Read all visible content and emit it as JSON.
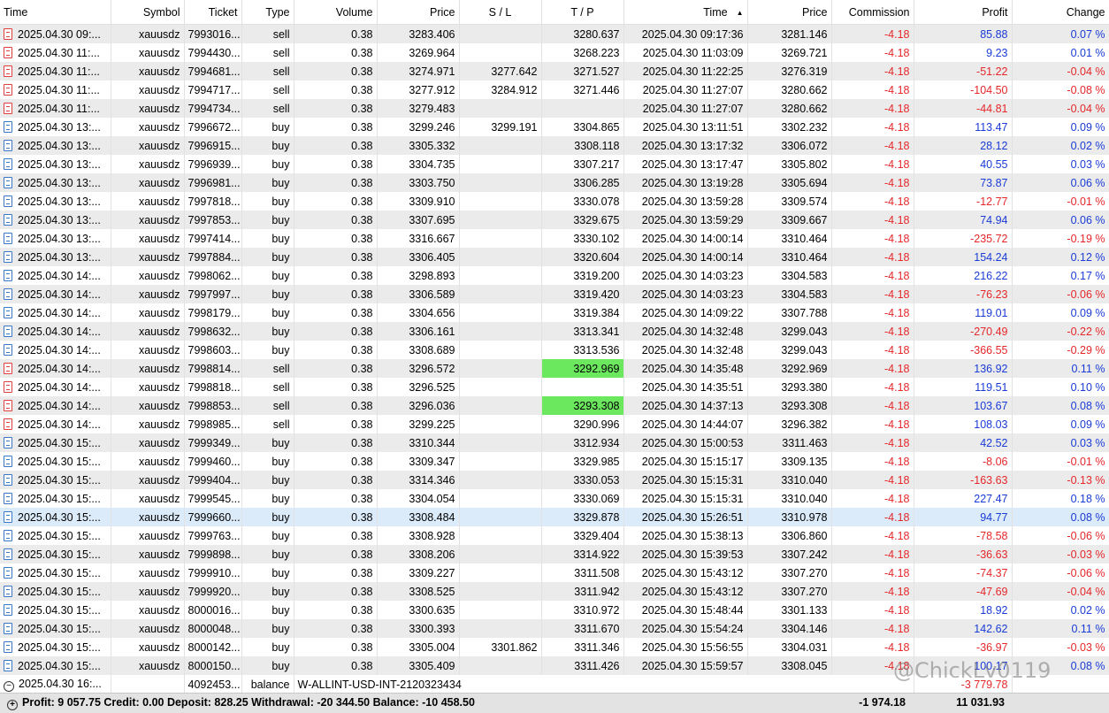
{
  "columns": [
    "Time",
    "Symbol",
    "Ticket",
    "Type",
    "Volume",
    "Price",
    "S / L",
    "T / P",
    "Time",
    "Price",
    "Commission",
    "Profit",
    "Change"
  ],
  "sorted_column_icon": "sort-ascending-icon",
  "rows": [
    {
      "type": "sell",
      "open_time": "2025.04.30 09:...",
      "symbol": "xauusdz",
      "ticket": "7993016...",
      "volume": "0.38",
      "price": "3283.406",
      "sl": "",
      "tp": "3280.637",
      "close_time": "2025.04.30 09:17:36",
      "close_price": "3281.146",
      "commission": "-4.18",
      "profit": "85.88",
      "change": "0.07 %"
    },
    {
      "type": "sell",
      "open_time": "2025.04.30 11:...",
      "symbol": "xauusdz",
      "ticket": "7994430...",
      "volume": "0.38",
      "price": "3269.964",
      "sl": "",
      "tp": "3268.223",
      "close_time": "2025.04.30 11:03:09",
      "close_price": "3269.721",
      "commission": "-4.18",
      "profit": "9.23",
      "change": "0.01 %"
    },
    {
      "type": "sell",
      "open_time": "2025.04.30 11:...",
      "symbol": "xauusdz",
      "ticket": "7994681...",
      "volume": "0.38",
      "price": "3274.971",
      "sl": "3277.642",
      "tp": "3271.527",
      "close_time": "2025.04.30 11:22:25",
      "close_price": "3276.319",
      "commission": "-4.18",
      "profit": "-51.22",
      "change": "-0.04 %"
    },
    {
      "type": "sell",
      "open_time": "2025.04.30 11:...",
      "symbol": "xauusdz",
      "ticket": "7994717...",
      "volume": "0.38",
      "price": "3277.912",
      "sl": "3284.912",
      "tp": "3271.446",
      "close_time": "2025.04.30 11:27:07",
      "close_price": "3280.662",
      "commission": "-4.18",
      "profit": "-104.50",
      "change": "-0.08 %"
    },
    {
      "type": "sell",
      "open_time": "2025.04.30 11:...",
      "symbol": "xauusdz",
      "ticket": "7994734...",
      "volume": "0.38",
      "price": "3279.483",
      "sl": "",
      "tp": "",
      "close_time": "2025.04.30 11:27:07",
      "close_price": "3280.662",
      "commission": "-4.18",
      "profit": "-44.81",
      "change": "-0.04 %"
    },
    {
      "type": "buy",
      "open_time": "2025.04.30 13:...",
      "symbol": "xauusdz",
      "ticket": "7996672...",
      "volume": "0.38",
      "price": "3299.246",
      "sl": "3299.191",
      "tp": "3304.865",
      "close_time": "2025.04.30 13:11:51",
      "close_price": "3302.232",
      "commission": "-4.18",
      "profit": "113.47",
      "change": "0.09 %"
    },
    {
      "type": "buy",
      "open_time": "2025.04.30 13:...",
      "symbol": "xauusdz",
      "ticket": "7996915...",
      "volume": "0.38",
      "price": "3305.332",
      "sl": "",
      "tp": "3308.118",
      "close_time": "2025.04.30 13:17:32",
      "close_price": "3306.072",
      "commission": "-4.18",
      "profit": "28.12",
      "change": "0.02 %"
    },
    {
      "type": "buy",
      "open_time": "2025.04.30 13:...",
      "symbol": "xauusdz",
      "ticket": "7996939...",
      "volume": "0.38",
      "price": "3304.735",
      "sl": "",
      "tp": "3307.217",
      "close_time": "2025.04.30 13:17:47",
      "close_price": "3305.802",
      "commission": "-4.18",
      "profit": "40.55",
      "change": "0.03 %"
    },
    {
      "type": "buy",
      "open_time": "2025.04.30 13:...",
      "symbol": "xauusdz",
      "ticket": "7996981...",
      "volume": "0.38",
      "price": "3303.750",
      "sl": "",
      "tp": "3306.285",
      "close_time": "2025.04.30 13:19:28",
      "close_price": "3305.694",
      "commission": "-4.18",
      "profit": "73.87",
      "change": "0.06 %"
    },
    {
      "type": "buy",
      "open_time": "2025.04.30 13:...",
      "symbol": "xauusdz",
      "ticket": "7997818...",
      "volume": "0.38",
      "price": "3309.910",
      "sl": "",
      "tp": "3330.078",
      "close_time": "2025.04.30 13:59:28",
      "close_price": "3309.574",
      "commission": "-4.18",
      "profit": "-12.77",
      "change": "-0.01 %"
    },
    {
      "type": "buy",
      "open_time": "2025.04.30 13:...",
      "symbol": "xauusdz",
      "ticket": "7997853...",
      "volume": "0.38",
      "price": "3307.695",
      "sl": "",
      "tp": "3329.675",
      "close_time": "2025.04.30 13:59:29",
      "close_price": "3309.667",
      "commission": "-4.18",
      "profit": "74.94",
      "change": "0.06 %"
    },
    {
      "type": "buy",
      "open_time": "2025.04.30 13:...",
      "symbol": "xauusdz",
      "ticket": "7997414...",
      "volume": "0.38",
      "price": "3316.667",
      "sl": "",
      "tp": "3330.102",
      "close_time": "2025.04.30 14:00:14",
      "close_price": "3310.464",
      "commission": "-4.18",
      "profit": "-235.72",
      "change": "-0.19 %"
    },
    {
      "type": "buy",
      "open_time": "2025.04.30 13:...",
      "symbol": "xauusdz",
      "ticket": "7997884...",
      "volume": "0.38",
      "price": "3306.405",
      "sl": "",
      "tp": "3320.604",
      "close_time": "2025.04.30 14:00:14",
      "close_price": "3310.464",
      "commission": "-4.18",
      "profit": "154.24",
      "change": "0.12 %"
    },
    {
      "type": "buy",
      "open_time": "2025.04.30 14:...",
      "symbol": "xauusdz",
      "ticket": "7998062...",
      "volume": "0.38",
      "price": "3298.893",
      "sl": "",
      "tp": "3319.200",
      "close_time": "2025.04.30 14:03:23",
      "close_price": "3304.583",
      "commission": "-4.18",
      "profit": "216.22",
      "change": "0.17 %"
    },
    {
      "type": "buy",
      "open_time": "2025.04.30 14:...",
      "symbol": "xauusdz",
      "ticket": "7997997...",
      "volume": "0.38",
      "price": "3306.589",
      "sl": "",
      "tp": "3319.420",
      "close_time": "2025.04.30 14:03:23",
      "close_price": "3304.583",
      "commission": "-4.18",
      "profit": "-76.23",
      "change": "-0.06 %"
    },
    {
      "type": "buy",
      "open_time": "2025.04.30 14:...",
      "symbol": "xauusdz",
      "ticket": "7998179...",
      "volume": "0.38",
      "price": "3304.656",
      "sl": "",
      "tp": "3319.384",
      "close_time": "2025.04.30 14:09:22",
      "close_price": "3307.788",
      "commission": "-4.18",
      "profit": "119.01",
      "change": "0.09 %"
    },
    {
      "type": "buy",
      "open_time": "2025.04.30 14:...",
      "symbol": "xauusdz",
      "ticket": "7998632...",
      "volume": "0.38",
      "price": "3306.161",
      "sl": "",
      "tp": "3313.341",
      "close_time": "2025.04.30 14:32:48",
      "close_price": "3299.043",
      "commission": "-4.18",
      "profit": "-270.49",
      "change": "-0.22 %"
    },
    {
      "type": "buy",
      "open_time": "2025.04.30 14:...",
      "symbol": "xauusdz",
      "ticket": "7998603...",
      "volume": "0.38",
      "price": "3308.689",
      "sl": "",
      "tp": "3313.536",
      "close_time": "2025.04.30 14:32:48",
      "close_price": "3299.043",
      "commission": "-4.18",
      "profit": "-366.55",
      "change": "-0.29 %"
    },
    {
      "type": "sell",
      "open_time": "2025.04.30 14:...",
      "symbol": "xauusdz",
      "ticket": "7998814...",
      "volume": "0.38",
      "price": "3296.572",
      "sl": "",
      "tp": "3292.969",
      "tp_hit": true,
      "close_time": "2025.04.30 14:35:48",
      "close_price": "3292.969",
      "commission": "-4.18",
      "profit": "136.92",
      "change": "0.11 %"
    },
    {
      "type": "sell",
      "open_time": "2025.04.30 14:...",
      "symbol": "xauusdz",
      "ticket": "7998818...",
      "volume": "0.38",
      "price": "3296.525",
      "sl": "",
      "tp": "",
      "close_time": "2025.04.30 14:35:51",
      "close_price": "3293.380",
      "commission": "-4.18",
      "profit": "119.51",
      "change": "0.10 %"
    },
    {
      "type": "sell",
      "open_time": "2025.04.30 14:...",
      "symbol": "xauusdz",
      "ticket": "7998853...",
      "volume": "0.38",
      "price": "3296.036",
      "sl": "",
      "tp": "3293.308",
      "tp_hit": true,
      "close_time": "2025.04.30 14:37:13",
      "close_price": "3293.308",
      "commission": "-4.18",
      "profit": "103.67",
      "change": "0.08 %"
    },
    {
      "type": "sell",
      "open_time": "2025.04.30 14:...",
      "symbol": "xauusdz",
      "ticket": "7998985...",
      "volume": "0.38",
      "price": "3299.225",
      "sl": "",
      "tp": "3290.996",
      "close_time": "2025.04.30 14:44:07",
      "close_price": "3296.382",
      "commission": "-4.18",
      "profit": "108.03",
      "change": "0.09 %"
    },
    {
      "type": "buy",
      "open_time": "2025.04.30 15:...",
      "symbol": "xauusdz",
      "ticket": "7999349...",
      "volume": "0.38",
      "price": "3310.344",
      "sl": "",
      "tp": "3312.934",
      "close_time": "2025.04.30 15:00:53",
      "close_price": "3311.463",
      "commission": "-4.18",
      "profit": "42.52",
      "change": "0.03 %"
    },
    {
      "type": "buy",
      "open_time": "2025.04.30 15:...",
      "symbol": "xauusdz",
      "ticket": "7999460...",
      "volume": "0.38",
      "price": "3309.347",
      "sl": "",
      "tp": "3329.985",
      "close_time": "2025.04.30 15:15:17",
      "close_price": "3309.135",
      "commission": "-4.18",
      "profit": "-8.06",
      "change": "-0.01 %"
    },
    {
      "type": "buy",
      "open_time": "2025.04.30 15:...",
      "symbol": "xauusdz",
      "ticket": "7999404...",
      "volume": "0.38",
      "price": "3314.346",
      "sl": "",
      "tp": "3330.053",
      "close_time": "2025.04.30 15:15:31",
      "close_price": "3310.040",
      "commission": "-4.18",
      "profit": "-163.63",
      "change": "-0.13 %"
    },
    {
      "type": "buy",
      "open_time": "2025.04.30 15:...",
      "symbol": "xauusdz",
      "ticket": "7999545...",
      "volume": "0.38",
      "price": "3304.054",
      "sl": "",
      "tp": "3330.069",
      "close_time": "2025.04.30 15:15:31",
      "close_price": "3310.040",
      "commission": "-4.18",
      "profit": "227.47",
      "change": "0.18 %"
    },
    {
      "type": "buy",
      "open_time": "2025.04.30 15:...",
      "symbol": "xauusdz",
      "ticket": "7999660...",
      "volume": "0.38",
      "price": "3308.484",
      "sl": "",
      "tp": "3329.878",
      "close_time": "2025.04.30 15:26:51",
      "close_price": "3310.978",
      "commission": "-4.18",
      "profit": "94.77",
      "change": "0.08 %",
      "selected": true
    },
    {
      "type": "buy",
      "open_time": "2025.04.30 15:...",
      "symbol": "xauusdz",
      "ticket": "7999763...",
      "volume": "0.38",
      "price": "3308.928",
      "sl": "",
      "tp": "3329.404",
      "close_time": "2025.04.30 15:38:13",
      "close_price": "3306.860",
      "commission": "-4.18",
      "profit": "-78.58",
      "change": "-0.06 %"
    },
    {
      "type": "buy",
      "open_time": "2025.04.30 15:...",
      "symbol": "xauusdz",
      "ticket": "7999898...",
      "volume": "0.38",
      "price": "3308.206",
      "sl": "",
      "tp": "3314.922",
      "close_time": "2025.04.30 15:39:53",
      "close_price": "3307.242",
      "commission": "-4.18",
      "profit": "-36.63",
      "change": "-0.03 %"
    },
    {
      "type": "buy",
      "open_time": "2025.04.30 15:...",
      "symbol": "xauusdz",
      "ticket": "7999910...",
      "volume": "0.38",
      "price": "3309.227",
      "sl": "",
      "tp": "3311.508",
      "close_time": "2025.04.30 15:43:12",
      "close_price": "3307.270",
      "commission": "-4.18",
      "profit": "-74.37",
      "change": "-0.06 %"
    },
    {
      "type": "buy",
      "open_time": "2025.04.30 15:...",
      "symbol": "xauusdz",
      "ticket": "7999920...",
      "volume": "0.38",
      "price": "3308.525",
      "sl": "",
      "tp": "3311.942",
      "close_time": "2025.04.30 15:43:12",
      "close_price": "3307.270",
      "commission": "-4.18",
      "profit": "-47.69",
      "change": "-0.04 %"
    },
    {
      "type": "buy",
      "open_time": "2025.04.30 15:...",
      "symbol": "xauusdz",
      "ticket": "8000016...",
      "volume": "0.38",
      "price": "3300.635",
      "sl": "",
      "tp": "3310.972",
      "close_time": "2025.04.30 15:48:44",
      "close_price": "3301.133",
      "commission": "-4.18",
      "profit": "18.92",
      "change": "0.02 %"
    },
    {
      "type": "buy",
      "open_time": "2025.04.30 15:...",
      "symbol": "xauusdz",
      "ticket": "8000048...",
      "volume": "0.38",
      "price": "3300.393",
      "sl": "",
      "tp": "3311.670",
      "close_time": "2025.04.30 15:54:24",
      "close_price": "3304.146",
      "commission": "-4.18",
      "profit": "142.62",
      "change": "0.11 %"
    },
    {
      "type": "buy",
      "open_time": "2025.04.30 15:...",
      "symbol": "xauusdz",
      "ticket": "8000142...",
      "volume": "0.38",
      "price": "3305.004",
      "sl": "3301.862",
      "tp": "3311.346",
      "close_time": "2025.04.30 15:56:55",
      "close_price": "3304.031",
      "commission": "-4.18",
      "profit": "-36.97",
      "change": "-0.03 %"
    },
    {
      "type": "buy",
      "open_time": "2025.04.30 15:...",
      "symbol": "xauusdz",
      "ticket": "8000150...",
      "volume": "0.38",
      "price": "3305.409",
      "sl": "",
      "tp": "3311.426",
      "close_time": "2025.04.30 15:59:57",
      "close_price": "3308.045",
      "commission": "-4.18",
      "profit": "100.17",
      "change": "0.08 %"
    }
  ],
  "balance_row": {
    "open_time": "2025.04.30 16:...",
    "ticket": "4092453...",
    "type": "balance",
    "comment": "W-ALLINT-USD-INT-2120323434",
    "profit": "-3 779.78"
  },
  "footer": {
    "summary": "Profit: 9 057.75  Credit: 0.00  Deposit: 828.25  Withdrawal: -20 344.50  Balance: -10 458.50",
    "commission": "-1 974.18",
    "profit": "11 031.93"
  },
  "watermark": "@ChickLv0119",
  "colors": {
    "negative": "#e5272a",
    "positive": "#1a3bd6",
    "tp_hit": "#6be85e",
    "selected_row": "#dcebfa"
  }
}
